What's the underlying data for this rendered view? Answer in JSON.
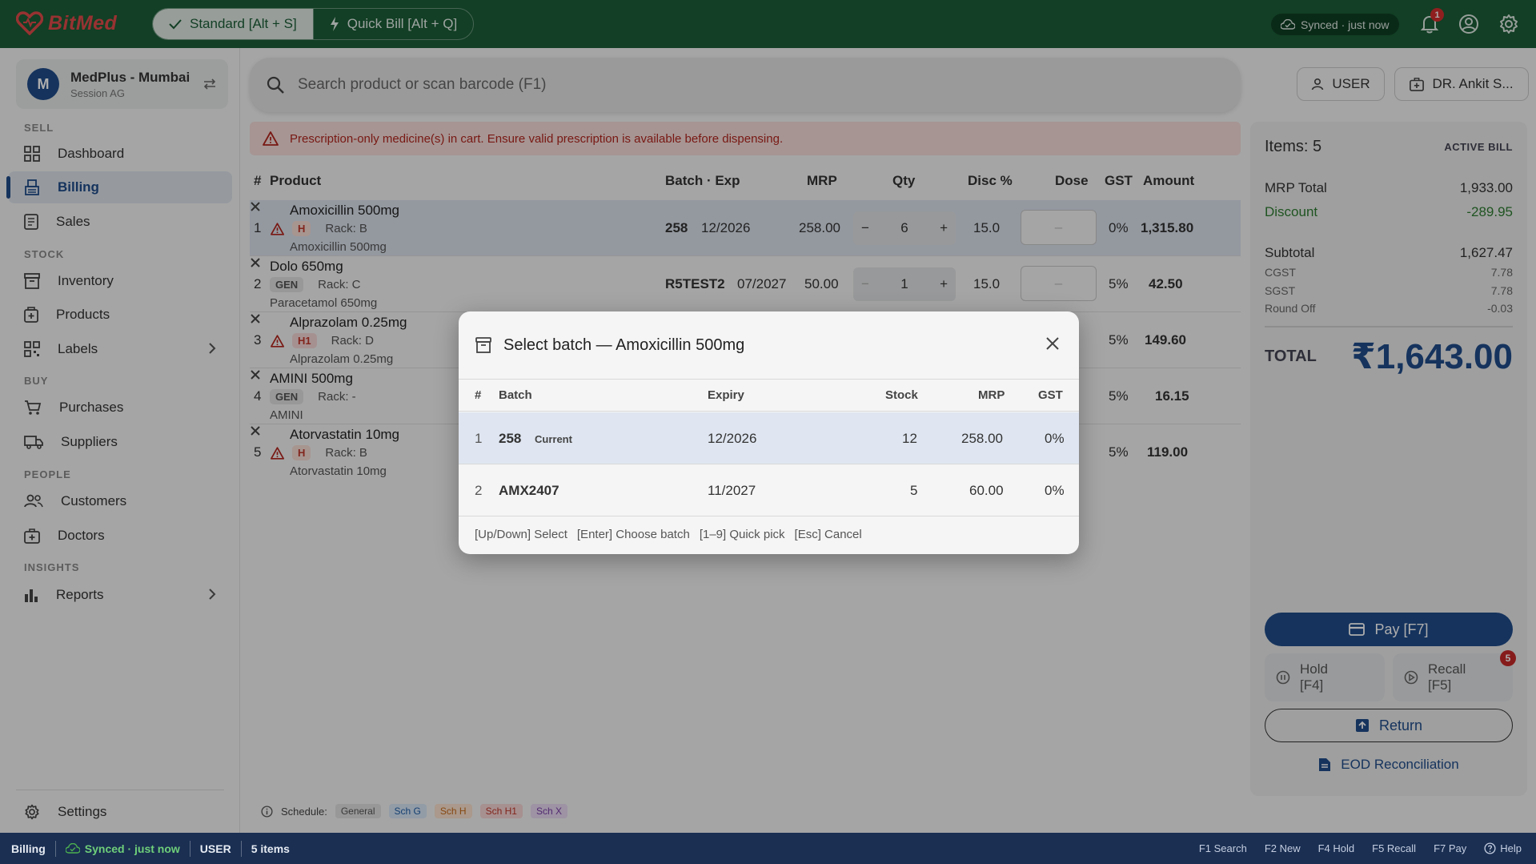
{
  "app": {
    "logo_text": "BitMed",
    "brand_color": "#1b5e37",
    "accent_color": "#1f4c8a"
  },
  "topbar": {
    "modes": [
      {
        "label": "Standard [Alt + S]",
        "icon": "check-icon",
        "active": true
      },
      {
        "label": "Quick Bill [Alt + Q]",
        "icon": "bolt-icon",
        "active": false
      }
    ],
    "sync_status": "Synced · just now",
    "notification_count": "1"
  },
  "store": {
    "avatar_letter": "M",
    "name": "MedPlus - Mumbai",
    "session": "Session AG"
  },
  "sidebar": {
    "sections": [
      {
        "title": "SELL",
        "items": [
          {
            "label": "Dashboard",
            "icon": "dashboard-icon"
          },
          {
            "label": "Billing",
            "icon": "billing-icon",
            "active": true
          },
          {
            "label": "Sales",
            "icon": "receipt-icon"
          }
        ]
      },
      {
        "title": "STOCK",
        "items": [
          {
            "label": "Inventory",
            "icon": "inventory-icon"
          },
          {
            "label": "Products",
            "icon": "medkit-icon"
          },
          {
            "label": "Labels",
            "icon": "qr-icon",
            "chevron": true
          }
        ]
      },
      {
        "title": "BUY",
        "items": [
          {
            "label": "Purchases",
            "icon": "cart-icon"
          },
          {
            "label": "Suppliers",
            "icon": "truck-icon"
          }
        ]
      },
      {
        "title": "PEOPLE",
        "items": [
          {
            "label": "Customers",
            "icon": "people-icon"
          },
          {
            "label": "Doctors",
            "icon": "doctor-icon"
          }
        ]
      },
      {
        "title": "INSIGHTS",
        "items": [
          {
            "label": "Reports",
            "icon": "bar-chart-icon",
            "chevron": true
          }
        ]
      }
    ],
    "settings_label": "Settings"
  },
  "search": {
    "placeholder": "Search product or scan barcode (F1)",
    "user_button": "USER",
    "doctor_button": "DR. Ankit S..."
  },
  "warning": {
    "text": "Prescription-only medicine(s) in cart. Ensure valid prescription is available before dispensing."
  },
  "cart": {
    "headers": {
      "num": "#",
      "product": "Product",
      "batch_exp": "Batch · Exp",
      "mrp": "MRP",
      "qty": "Qty",
      "disc": "Disc %",
      "dose": "Dose",
      "gst": "GST",
      "amount": "Amount"
    },
    "rows": [
      {
        "num": "1",
        "name": "Amoxicillin 500mg",
        "schedule": "H",
        "rack": "Rack: B",
        "generic": "Amoxicillin 500mg",
        "warn": true,
        "batch": "258",
        "exp": "12/2026",
        "mrp": "258.00",
        "qty": "6",
        "disc": "15.0",
        "dose": "–",
        "gst": "0%",
        "amount": "1,315.80"
      },
      {
        "num": "2",
        "name": "Dolo 650mg",
        "schedule": "GEN",
        "rack": "Rack: C",
        "generic": "Paracetamol 650mg",
        "warn": false,
        "batch": "R5TEST2",
        "exp": "07/2027",
        "mrp": "50.00",
        "qty": "1",
        "disc": "15.0",
        "dose": "–",
        "gst": "5%",
        "amount": "42.50"
      },
      {
        "num": "3",
        "name": "Alprazolam 0.25mg",
        "schedule": "H1",
        "rack": "Rack: D",
        "generic": "Alprazolam 0.25mg",
        "warn": true,
        "gst": "5%",
        "amount": "149.60"
      },
      {
        "num": "4",
        "name": "AMINI 500mg",
        "schedule": "GEN",
        "rack": "Rack: -",
        "generic": "AMINI",
        "warn": false,
        "gst": "5%",
        "amount": "16.15"
      },
      {
        "num": "5",
        "name": "Atorvastatin 10mg",
        "schedule": "H",
        "rack": "Rack: B",
        "generic": "Atorvastatin 10mg",
        "warn": true,
        "gst": "5%",
        "amount": "119.00"
      }
    ]
  },
  "bill": {
    "items_label": "Items: 5",
    "status": "ACTIVE BILL",
    "mrp_total_label": "MRP Total",
    "mrp_total": "1,933.00",
    "discount_label": "Discount",
    "discount": "-289.95",
    "subtotal_label": "Subtotal",
    "subtotal": "1,627.47",
    "cgst_label": "CGST",
    "cgst": "7.78",
    "sgst_label": "SGST",
    "sgst": "7.78",
    "roundoff_label": "Round Off",
    "roundoff": "-0.03",
    "total_label": "TOTAL",
    "total": "₹1,643.00",
    "pay_label": "Pay  [F7]",
    "hold_label": "Hold",
    "hold_key": "[F4]",
    "recall_label": "Recall",
    "recall_key": "[F5]",
    "recall_count": "5",
    "return_label": "Return",
    "eod_label": "EOD Reconciliation"
  },
  "legend": {
    "label": "Schedule:",
    "items": [
      "General",
      "Sch G",
      "Sch H",
      "Sch H1",
      "Sch X"
    ]
  },
  "statusbar": {
    "page": "Billing",
    "sync": "Synced · just now",
    "user": "USER",
    "items": "5 items",
    "shortcuts": [
      "F1 Search",
      "F2 New",
      "F4 Hold",
      "F5 Recall",
      "F7 Pay",
      "Help"
    ]
  },
  "modal": {
    "title": "Select batch — Amoxicillin 500mg",
    "headers": {
      "num": "#",
      "batch": "Batch",
      "expiry": "Expiry",
      "stock": "Stock",
      "mrp": "MRP",
      "gst": "GST"
    },
    "rows": [
      {
        "num": "1",
        "batch": "258",
        "tag": "Current",
        "expiry": "12/2026",
        "stock": "12",
        "mrp": "258.00",
        "gst": "0%"
      },
      {
        "num": "2",
        "batch": "AMX2407",
        "tag": "",
        "expiry": "11/2027",
        "stock": "5",
        "mrp": "60.00",
        "gst": "0%"
      }
    ],
    "hints": [
      "[Up/Down] Select",
      "[Enter] Choose batch",
      "[1–9] Quick pick",
      "[Esc] Cancel"
    ]
  }
}
